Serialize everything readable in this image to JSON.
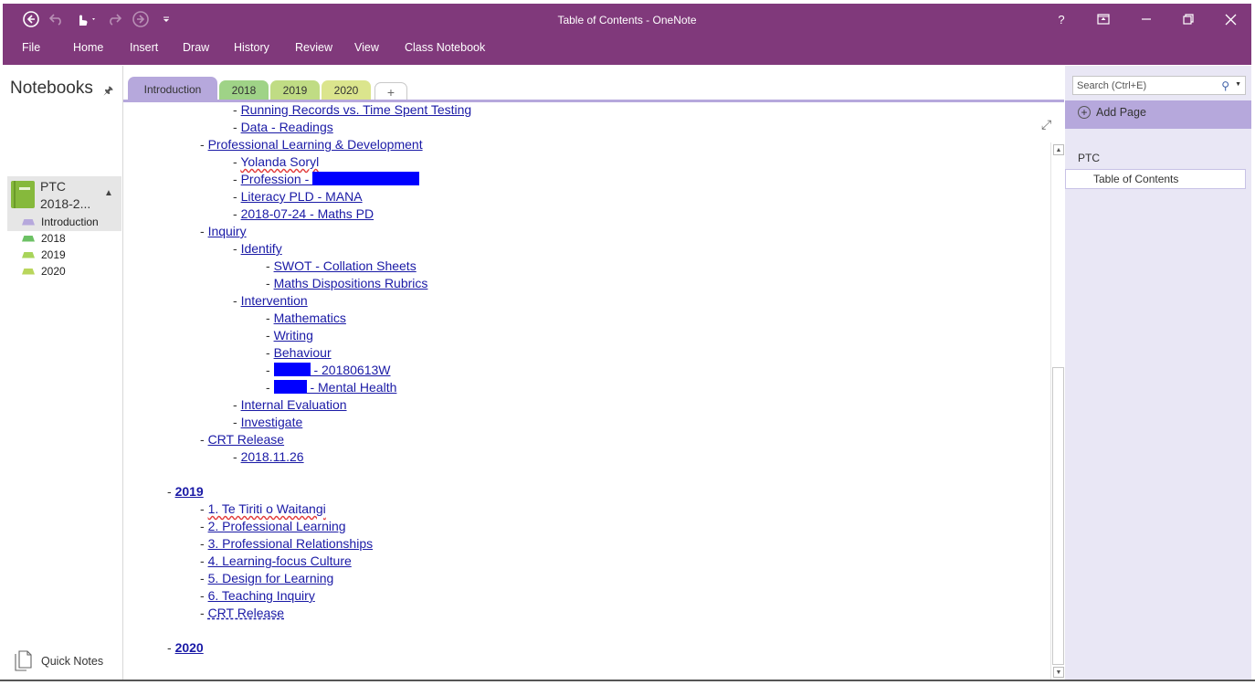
{
  "window": {
    "title": "Table of Contents - OneNote",
    "help": "?",
    "accent_color": "#80397b"
  },
  "quick_access": {
    "back_icon": "back-circle-icon",
    "undo_icon": "undo-icon",
    "touch_icon": "touch-mode-icon",
    "redo_icon": "redo-icon",
    "forward_icon": "forward-circle-icon",
    "customize_icon": "customize-qat-icon"
  },
  "ribbon": {
    "tabs": [
      "File",
      "Home",
      "Insert",
      "Draw",
      "History",
      "Review",
      "View",
      "Class Notebook"
    ]
  },
  "left_nav": {
    "title": "Notebooks",
    "notebook": {
      "name_line1": "PTC",
      "name_line2": "2018-2...",
      "color": "#86b93c"
    },
    "sections": [
      {
        "label": "Introduction",
        "color": "#b6a8dc"
      },
      {
        "label": "2018",
        "color": "#6cc164"
      },
      {
        "label": "2019",
        "color": "#a8d45a"
      },
      {
        "label": "2020",
        "color": "#b9d65c"
      }
    ],
    "quick_notes": "Quick Notes"
  },
  "section_tabs": {
    "tabs": [
      "Introduction",
      "2018",
      "2019",
      "2020"
    ],
    "add": "+"
  },
  "content": {
    "lines": [
      {
        "dash": "- ",
        "text": "Running Records vs. Time Spent Testing"
      },
      {
        "dash": "- ",
        "text": "Data - Readings"
      },
      {
        "dash": "- ",
        "text": "Professional Learning & Development"
      },
      {
        "dash": "- ",
        "text": "Yolanda Soryl"
      },
      {
        "dash": "- ",
        "text": "Profession - "
      },
      {
        "dash": "- ",
        "text": "Literacy PLD - MANA"
      },
      {
        "dash": "- ",
        "text": "2018-07-24 - Maths PD"
      },
      {
        "dash": "- ",
        "text": "Inquiry"
      },
      {
        "dash": "- ",
        "text": "Identify"
      },
      {
        "dash": "- ",
        "text": "SWOT - Collation Sheets"
      },
      {
        "dash": "- ",
        "text": "Maths Dispositions Rubrics"
      },
      {
        "dash": "- ",
        "text": "Intervention"
      },
      {
        "dash": "- ",
        "text": "Mathematics"
      },
      {
        "dash": "- ",
        "text": "Writing"
      },
      {
        "dash": "- ",
        "text": "Behaviour"
      },
      {
        "dash": "- ",
        "text": " - 20180613W"
      },
      {
        "dash": "- ",
        "text": " - Mental Health"
      },
      {
        "dash": "- ",
        "text": "Internal Evaluation"
      },
      {
        "dash": "- ",
        "text": "Investigate"
      },
      {
        "dash": "- ",
        "text": "CRT Release"
      },
      {
        "dash": "- ",
        "text": "2018.11.26"
      },
      {
        "dash": "- ",
        "text": "2019"
      },
      {
        "dash": "- ",
        "text": "1. Te Tiriti o Waitangi"
      },
      {
        "dash": "- ",
        "text": "2. Professional Learning"
      },
      {
        "dash": "- ",
        "text": "3. Professional Relationships"
      },
      {
        "dash": "- ",
        "text": "4. Learning-focus Culture"
      },
      {
        "dash": "- ",
        "text": "5. Design for Learning"
      },
      {
        "dash": "- ",
        "text": "6. Teaching Inquiry"
      },
      {
        "dash": "- ",
        "text": "CRT Release"
      },
      {
        "dash": "- ",
        "text": "2020"
      }
    ]
  },
  "right_pane": {
    "search_placeholder": "Search (Ctrl+E)",
    "add_page": "Add Page",
    "section_label": "PTC",
    "pages": [
      "Table of Contents"
    ]
  }
}
